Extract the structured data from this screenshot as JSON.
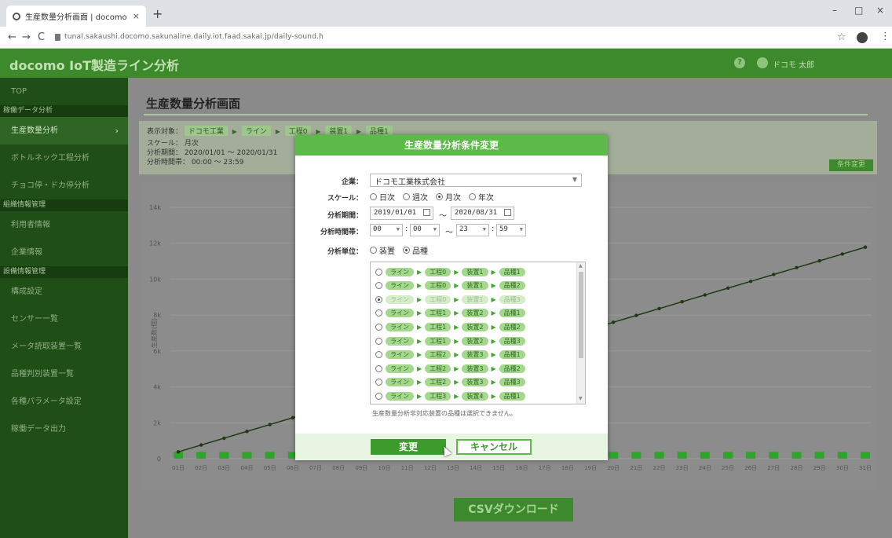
{
  "browser": {
    "tab_title": "生産数量分析画面 | docomo IoT",
    "tab_close": "×",
    "new_tab": "+",
    "url": "tunal.sakaushi.docomo.sakunaline.daily.iot.faad.sakai.jp/daily-sound.h",
    "minimize": "–",
    "maximize": "□",
    "close": "×",
    "back": "←",
    "forward": "→",
    "reload": "C",
    "star": "☆",
    "menu": "⋮"
  },
  "header": {
    "brand": "docomo IoT製造ライン分析",
    "help": "?",
    "user_name": "ドコモ 太郎"
  },
  "sidebar": {
    "items": [
      {
        "label": "TOP",
        "type": "item"
      },
      {
        "label": "稼働データ分析",
        "type": "section"
      },
      {
        "label": "生産数量分析",
        "type": "item",
        "active": true
      },
      {
        "label": "ボトルネック工程分析",
        "type": "item"
      },
      {
        "label": "チョコ停・ドカ停分析",
        "type": "item"
      },
      {
        "label": "組織情報管理",
        "type": "section"
      },
      {
        "label": "利用者情報",
        "type": "item"
      },
      {
        "label": "企業情報",
        "type": "item"
      },
      {
        "label": "設備情報管理",
        "type": "section"
      },
      {
        "label": "構成設定",
        "type": "item"
      },
      {
        "label": "センサー一覧",
        "type": "item"
      },
      {
        "label": "メータ読取装置一覧",
        "type": "item"
      },
      {
        "label": "品種判別装置一覧",
        "type": "item"
      },
      {
        "label": "各種パラメータ設定",
        "type": "item"
      },
      {
        "label": "稼働データ出力",
        "type": "item"
      }
    ],
    "active_arrow": "›"
  },
  "page": {
    "title": "生産数量分析画面",
    "target_label": "表示対象：",
    "target_company": "ドコモ工業",
    "crumbs": [
      "ライン",
      "工程0",
      "装置1",
      "品種1"
    ],
    "scale_label": "スケール：",
    "scale_value": "月次",
    "period_label": "分析期間：",
    "period_value": "2020/01/01 ～ 2020/01/31",
    "time_label": "分析時間帯：",
    "time_value": "00:00 ～ 23:59",
    "change_button": "条件変更",
    "csv_button": "CSVダウンロード"
  },
  "chart_data": {
    "type": "line",
    "ylabel": "生産数(個)",
    "ylim": [
      0,
      14000
    ],
    "y_ticks": [
      "0",
      "2k",
      "4k",
      "6k",
      "8k",
      "10k",
      "12k",
      "14k"
    ],
    "categories": [
      "01日",
      "02日",
      "03日",
      "04日",
      "05日",
      "06日",
      "07日",
      "08日",
      "09日",
      "10日",
      "11日",
      "12日",
      "13日",
      "14日",
      "15日",
      "16日",
      "17日",
      "18日",
      "19日",
      "20日",
      "21日",
      "22日",
      "23日",
      "24日",
      "25日",
      "26日",
      "27日",
      "28日",
      "29日",
      "30日",
      "31日"
    ],
    "series": [
      {
        "values": [
          380,
          760,
          1140,
          1520,
          1900,
          2280,
          2660,
          3040,
          3420,
          3800,
          4180,
          4560,
          4940,
          5320,
          5700,
          6080,
          6460,
          6840,
          7220,
          7600,
          7980,
          8360,
          8740,
          9120,
          9500,
          9880,
          10260,
          10640,
          11020,
          11400,
          11780
        ]
      },
      {
        "values": [
          380,
          380,
          380,
          380,
          380,
          380,
          380,
          380,
          380,
          380,
          380,
          380,
          380,
          380,
          380,
          380,
          380,
          380,
          380,
          380,
          380,
          380,
          380,
          380,
          380,
          380,
          380,
          380,
          380,
          380,
          380
        ]
      }
    ],
    "colors": {
      "line": "#1e3a14",
      "bar": "#2ea52a"
    }
  },
  "modal": {
    "title": "生産数量分析条件変更",
    "company_label": "企業：",
    "company_value": "ドコモ工業株式会社",
    "scale_label": "スケール：",
    "scale_options": [
      {
        "label": "日次",
        "checked": false
      },
      {
        "label": "週次",
        "checked": false
      },
      {
        "label": "月次",
        "checked": true
      },
      {
        "label": "年次",
        "checked": false
      }
    ],
    "period_label": "分析期間：",
    "period_from": "2019/01/01",
    "period_to": "2020/08/31",
    "tilde": "～",
    "time_label": "分析時間帯：",
    "time_from_h": "00",
    "time_from_m": "00",
    "time_to_h": "23",
    "time_to_m": "59",
    "colon": ":",
    "unit_label": "分析単位：",
    "unit_options": [
      {
        "label": "装置",
        "checked": false
      },
      {
        "label": "品種",
        "checked": true
      }
    ],
    "list_rows": [
      {
        "line": "ライン",
        "process": "工程0",
        "device": "装置1",
        "product": "品種1",
        "selected": false
      },
      {
        "line": "ライン",
        "process": "工程0",
        "device": "装置1",
        "product": "品種2",
        "selected": false
      },
      {
        "line": "ライン",
        "process": "工程0",
        "device": "装置1",
        "product": "品種3",
        "selected": true
      },
      {
        "line": "ライン",
        "process": "工程1",
        "device": "装置2",
        "product": "品種1",
        "selected": false
      },
      {
        "line": "ライン",
        "process": "工程1",
        "device": "装置2",
        "product": "品種2",
        "selected": false
      },
      {
        "line": "ライン",
        "process": "工程1",
        "device": "装置2",
        "product": "品種3",
        "selected": false
      },
      {
        "line": "ライン",
        "process": "工程2",
        "device": "装置3",
        "product": "品種1",
        "selected": false
      },
      {
        "line": "ライン",
        "process": "工程2",
        "device": "装置3",
        "product": "品種2",
        "selected": false
      },
      {
        "line": "ライン",
        "process": "工程2",
        "device": "装置3",
        "product": "品種3",
        "selected": false
      },
      {
        "line": "ライン",
        "process": "工程3",
        "device": "装置4",
        "product": "品種1",
        "selected": false
      }
    ],
    "note": "生産数量分析非対応装置の品種は選択できません。",
    "ok_button": "変更",
    "cancel_button": "キャンセル"
  }
}
